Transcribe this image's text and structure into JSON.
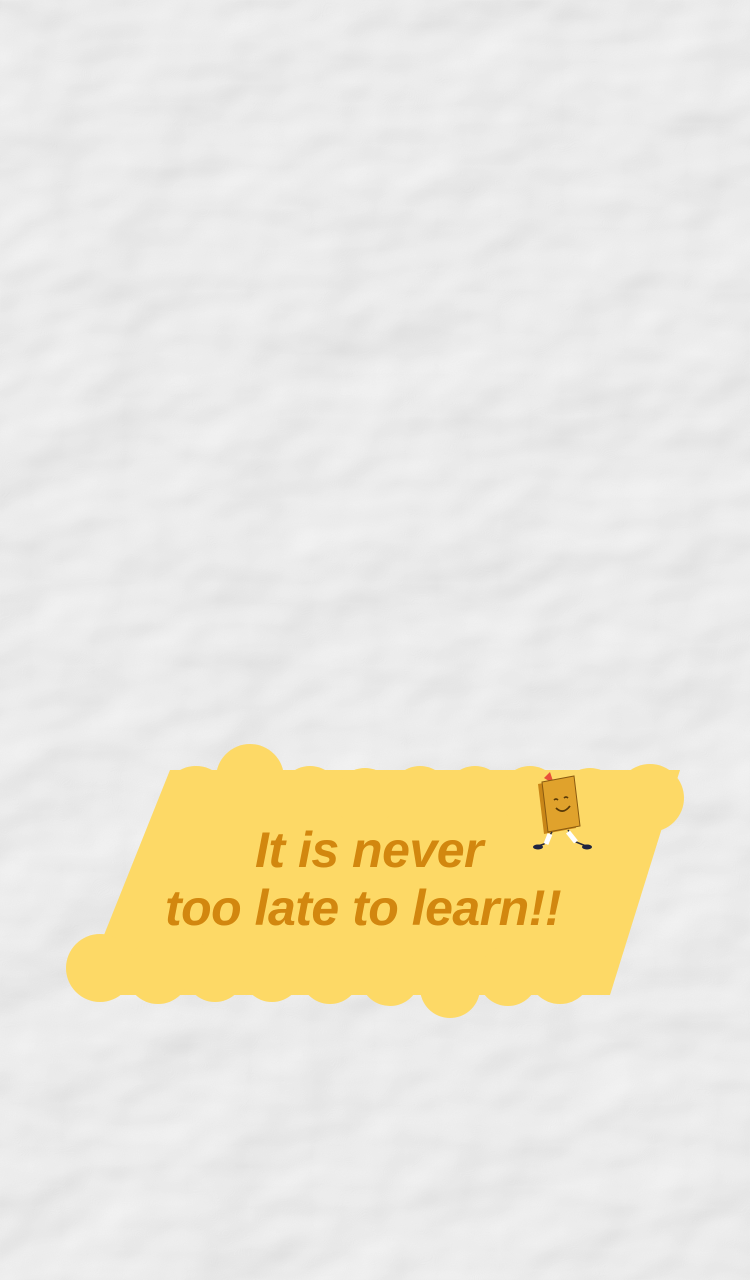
{
  "quote": {
    "line1": "It is never",
    "line2": "too late to learn!!"
  },
  "colors": {
    "paper": "#F1F1F1",
    "banner": "#FDD966",
    "text": "#D2870F",
    "book": "#E0A22C"
  },
  "icons": {
    "mascot": "walking-book-icon"
  }
}
